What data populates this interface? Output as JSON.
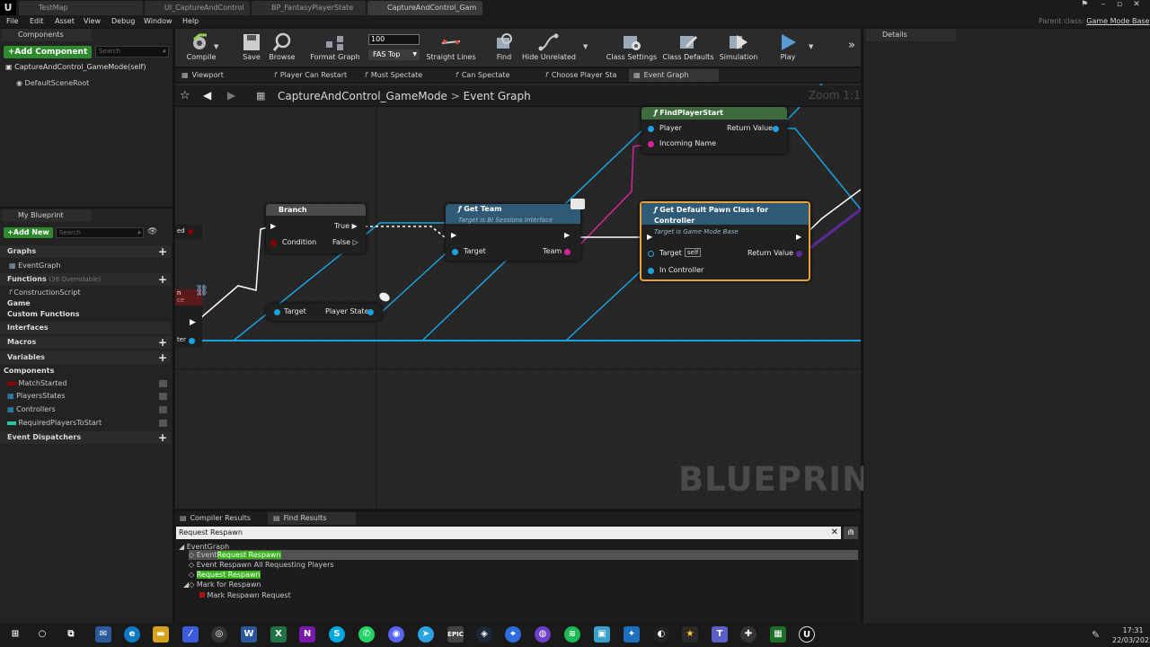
{
  "tabs": [
    {
      "label": "TestMap"
    },
    {
      "label": "UI_CaptureAndControl"
    },
    {
      "label": "BP_FantasyPlayerState"
    },
    {
      "label": "CaptureAndControl_Gam"
    }
  ],
  "menu": [
    "File",
    "Edit",
    "Asset",
    "View",
    "Debug",
    "Window",
    "Help"
  ],
  "parent_class": {
    "label": "Parent class:",
    "value": "Game Mode Base"
  },
  "components": {
    "title": "Components",
    "add_label": "+Add Component",
    "search_placeholder": "Search",
    "root": "CaptureAndControl_GameMode(self)",
    "child": "DefaultSceneRoot"
  },
  "my_blueprint": {
    "title": "My Blueprint",
    "add_label": "+Add New",
    "search_placeholder": "Search",
    "graphs_label": "Graphs",
    "event_graph": "EventGraph",
    "functions_label": "Functions",
    "functions_count": "(36 Overridable)",
    "function_items": [
      "ConstructionScript",
      "Game",
      "Custom Functions",
      "Interfaces"
    ],
    "macros_label": "Macros",
    "variables_label": "Variables",
    "components_label": "Components",
    "variables": [
      "MatchStarted",
      "PlayersStates",
      "Controllers",
      "RequiredPlayersToStart"
    ],
    "dispatchers_label": "Event Dispatchers"
  },
  "toolbar": {
    "compile": "Compile",
    "save": "Save",
    "browse": "Browse",
    "format_graph": "Format Graph",
    "zoom_value": "100",
    "fas_top": "FAS Top",
    "straight_lines": "Straight Lines",
    "find": "Find",
    "hide_unrelated": "Hide Unrelated",
    "class_settings": "Class Settings",
    "class_defaults": "Class Defaults",
    "simulation": "Simulation",
    "play": "Play"
  },
  "graph_tabs": [
    "Viewport",
    "Player Can Restart",
    "Must Spectate",
    "Can Spectate",
    "Choose Player Sta",
    "Event Graph"
  ],
  "breadcrumb": {
    "blueprint": "CaptureAndControl_GameMode",
    "graph": "Event Graph",
    "zoom": "Zoom 1:1"
  },
  "nodes": {
    "branch": {
      "title": "Branch",
      "true_pin": "True",
      "false_pin": "False",
      "condition": "Condition"
    },
    "get_team": {
      "title": "Get Team",
      "subtitle": "Target is BI Sessions Interface",
      "target": "Target",
      "team": "Team"
    },
    "find_player_start": {
      "title": "FindPlayerStart",
      "player": "Player",
      "incoming": "Incoming Name",
      "ret": "Return Value"
    },
    "get_pawn": {
      "title": "Get Default Pawn Class for Controller",
      "subtitle": "Target is Game Mode Base",
      "target": "Target",
      "self": "self",
      "in_controller": "In Controller",
      "ret": "Return Value"
    },
    "player_state": {
      "target": "Target",
      "player_state": "Player State"
    },
    "left_cut_1": "ed",
    "left_cut_2": "n",
    "left_cut_3": "ce",
    "left_cut_4": "ter"
  },
  "watermark": "BLUEPRINT",
  "bottom_tabs": {
    "compiler": "Compiler Results",
    "find": "Find Results"
  },
  "find": {
    "query": "Request Respawn",
    "root": "EventGraph",
    "r1_prefix": "Event",
    "r1_hl": "Request Respawn",
    "r2": "Event Respawn All Requesting Players",
    "r3_hl": "Request Respawn",
    "r4": "Mark for Respawn",
    "r5": "Mark Respawn Request"
  },
  "details": {
    "title": "Details"
  },
  "clock": {
    "time": "17:31",
    "date": "22/03/2022"
  },
  "colors": {
    "exec": "#ffffff",
    "object": "#1aa2e0",
    "struct": "#d4249c",
    "accent_green": "#2f8a2f",
    "highlight_green": "#37b21b",
    "selected_node": "#e9a23a"
  }
}
